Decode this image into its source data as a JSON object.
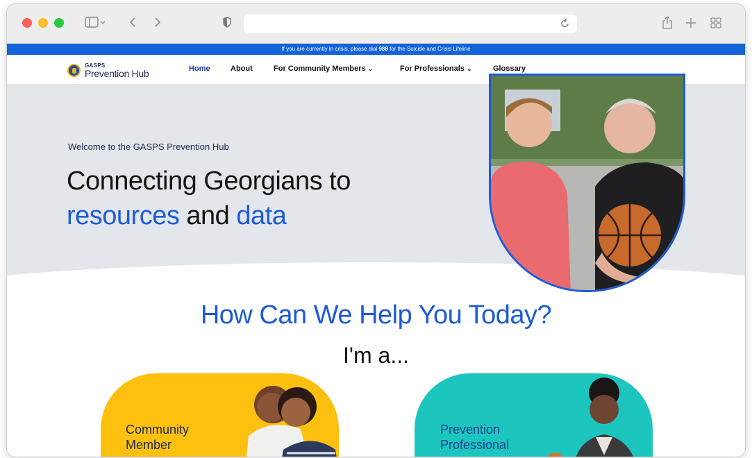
{
  "browser": {
    "address_text": "",
    "colors": {
      "chrome": "#ededed",
      "close": "#fe5f57",
      "minimize": "#febc2e",
      "zoom": "#28c840"
    }
  },
  "crisis_banner": {
    "prefix": "If you are currently in crisis, please dial ",
    "number": "988",
    "suffix": " for the Suicide and Crisis Lifeline",
    "color": "#1264d8"
  },
  "nav": {
    "logo_small": "GASPS",
    "logo_big": "Prevention Hub",
    "items": [
      {
        "label": "Home",
        "active": true
      },
      {
        "label": "About"
      },
      {
        "label": "For Community Members",
        "dropdown": true
      },
      {
        "label": "For Professionals",
        "dropdown": true
      },
      {
        "label": "Glossary"
      }
    ]
  },
  "hero": {
    "welcome": "Welcome to the GASPS Prevention Hub",
    "headline_line1": "Connecting Georgians to",
    "headline_word1": "resources",
    "headline_and": " and ",
    "headline_word2": "data",
    "accent_color": "#1c5bd6"
  },
  "help": {
    "title": "How Can We Help You Today?",
    "subtitle": "I'm a...",
    "cards": [
      {
        "line1": "Community",
        "line2": "Member",
        "color": "#fdc00f"
      },
      {
        "line1": "Prevention",
        "line2": "Professional",
        "color": "#1cc6bf"
      }
    ]
  }
}
